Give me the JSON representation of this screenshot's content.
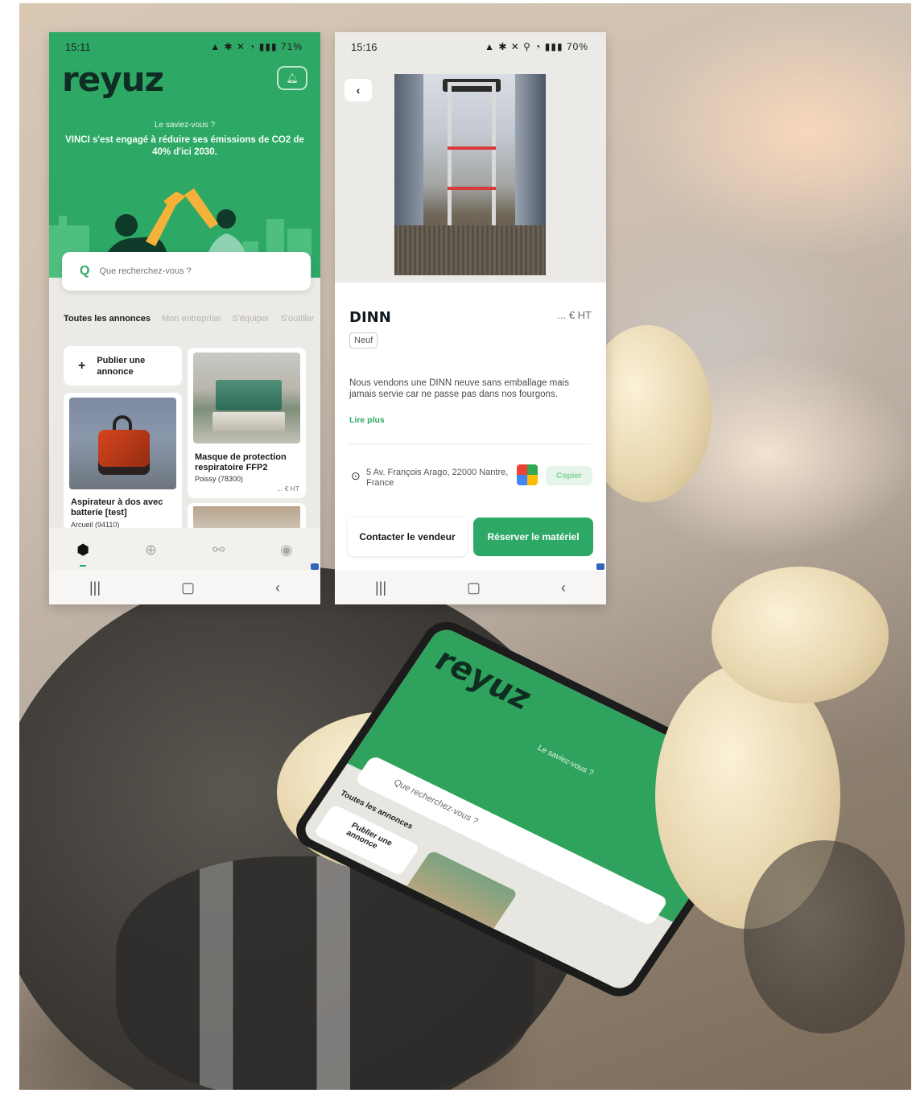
{
  "home": {
    "status": {
      "time": "15:11",
      "battery": "71%",
      "icons": "▲ ✱ ✕ ◔ ▮▮▮"
    },
    "logo": "reyuz",
    "notification_icon": "bell-icon",
    "fact_question": "Le saviez-vous ?",
    "fact_text": "VINCI s'est engagé à réduire ses émissions de CO2 de 40% d'ici 2030.",
    "search_placeholder": "Que recherchez-vous ?",
    "tabs": [
      "Toutes les annonces",
      "Mon entreprise",
      "S'équiper",
      "S'outiller"
    ],
    "publish_label": "Publier une annonce",
    "items": [
      {
        "title": "Aspirateur à dos avec batterie [test]",
        "city": "Arcueil (94110)"
      },
      {
        "title": "Masque de protection respiratoire FFP2",
        "city": "Poissy (78300)",
        "price": "... € HT"
      }
    ],
    "bottom_nav": [
      "home-icon",
      "add-icon",
      "handshake-icon",
      "profile-icon"
    ]
  },
  "detail": {
    "status": {
      "time": "15:16",
      "battery": "70%",
      "icons": "▲ ✱ ✕ ⚲ ◔ ▮▮▮"
    },
    "title": "DINN",
    "price": "... € HT",
    "condition": "Neuf",
    "description": "Nous vendons une DINN neuve sans emballage mais jamais servie car ne passe pas dans nos fourgons.",
    "read_more": "Lire plus",
    "address": "5 Av. François Arago, 22000 Nantre, France",
    "copy_label": "Copier",
    "contact_label": "Contacter le vendeur",
    "reserve_label": "Réserver le matériel"
  },
  "background_phone": {
    "logo": "reyuz",
    "fact_question": "Le saviez-vous ?",
    "search_placeholder": "Que recherchez-vous ?",
    "tab_active": "Toutes les annonces",
    "publish_label": "Publier une annonce"
  },
  "colors": {
    "brand_green": "#2ea865",
    "logo_dark": "#0f2d23"
  }
}
